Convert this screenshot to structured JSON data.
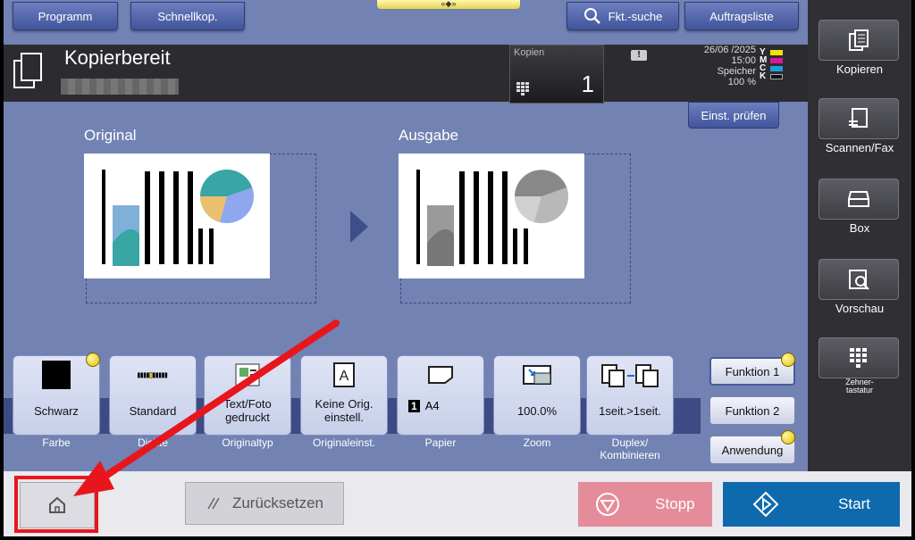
{
  "top": {
    "programm": "Programm",
    "schnellkop": "Schnellkop.",
    "handle": "«◆»",
    "search": "Fkt.-suche",
    "jobs": "Auftragsliste"
  },
  "status": {
    "title": "Kopierbereit",
    "copies_label": "Kopien",
    "copies_value": "1",
    "warning": "!",
    "date": "26/06 /2025",
    "time": "15:00",
    "memory_label": "Speicher",
    "memory_value": "100 %",
    "toner": [
      {
        "letter": "Y",
        "color": "#f2e300"
      },
      {
        "letter": "M",
        "color": "#e0149a"
      },
      {
        "letter": "C",
        "color": "#1aa0e0"
      },
      {
        "letter": "K",
        "color": "#111111"
      }
    ]
  },
  "check_settings": "Einst. prüfen",
  "preview": {
    "original_title": "Original",
    "output_title": "Ausgabe"
  },
  "functions": [
    {
      "value": "Schwarz",
      "label": "Farbe"
    },
    {
      "value": "Standard",
      "label": "Dichte"
    },
    {
      "value": "Text/Foto\ngedruckt",
      "label": "Originaltyp"
    },
    {
      "value": "Keine Orig.\neinstell.",
      "label": "Originaleinst."
    },
    {
      "value": "A4",
      "label": "Papier",
      "tray": "1"
    },
    {
      "value": "100.0%",
      "label": "Zoom"
    },
    {
      "value": "1seit.>1seit.",
      "label": "Duplex/\nKombinieren"
    }
  ],
  "side_functions": {
    "f1": "Funktion 1",
    "f2": "Funktion 2",
    "app": "Anwendung"
  },
  "sidebar": {
    "copy": "Kopieren",
    "scan": "Scannen/Fax",
    "box": "Box",
    "preview": "Vorschau",
    "keypad": "Zehner-\ntastatur"
  },
  "bottom": {
    "reset": "Zurücksetzen",
    "stop": "Stopp",
    "start": "Start"
  },
  "colors": {
    "accent": "#0f6aad",
    "stop": "#e58c9a",
    "highlight": "#e8161c"
  }
}
